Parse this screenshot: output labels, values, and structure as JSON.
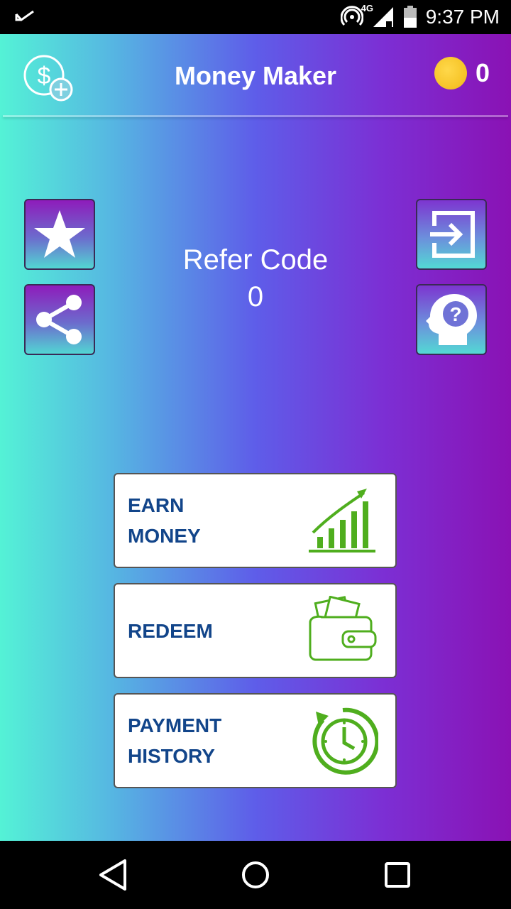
{
  "status_bar": {
    "network": "4G",
    "time": "9:37 PM"
  },
  "header": {
    "title": "Money Maker",
    "coin_count": "0",
    "add_money_icon": "dollar-plus-icon",
    "coin_icon": "coin-icon"
  },
  "side_buttons": {
    "rate_icon": "star-icon",
    "share_icon": "share-icon",
    "exit_icon": "exit-icon",
    "help_icon": "help-head-icon"
  },
  "refer": {
    "label": "Refer Code",
    "code": "0"
  },
  "actions": [
    {
      "label": "EARN\nMONEY",
      "icon": "growth-chart-icon"
    },
    {
      "label": "REDEEM",
      "icon": "wallet-icon"
    },
    {
      "label": "PAYMENT\nHISTORY",
      "icon": "clock-history-icon"
    }
  ],
  "colors": {
    "accent_green": "#4fae1e",
    "label_blue": "#12458a",
    "coin_gold": "#f7c62b"
  }
}
